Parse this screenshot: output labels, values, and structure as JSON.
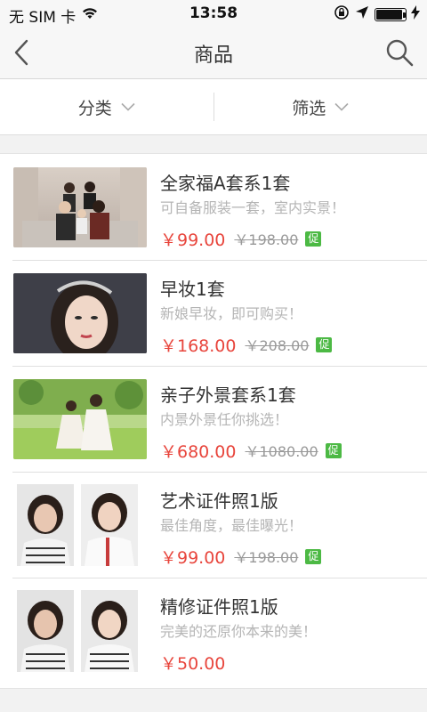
{
  "status_bar": {
    "carrier": "无 SIM 卡",
    "time": "13:58",
    "battery_level": 0.9
  },
  "nav": {
    "title": "商品",
    "back_icon": "chevron-left-icon",
    "search_icon": "search-icon"
  },
  "filters": [
    {
      "label": "分类",
      "icon": "chevron-down-icon"
    },
    {
      "label": "筛选",
      "icon": "chevron-down-icon"
    }
  ],
  "colors": {
    "price": "#e8453c",
    "promo_badge": "#4cb944"
  },
  "products": [
    {
      "title": "全家福A套系1套",
      "desc": "可自备服装一套，室内实景！",
      "price": "￥99.00",
      "old_price": "￥198.00",
      "badge": "促"
    },
    {
      "title": "早妆1套",
      "desc": "新娘早妆，即可购买！",
      "price": "￥168.00",
      "old_price": "￥208.00",
      "badge": "促"
    },
    {
      "title": "亲子外景套系1套",
      "desc": "内景外景任你挑选！",
      "price": "￥680.00",
      "old_price": "￥1080.00",
      "badge": "促"
    },
    {
      "title": "艺术证件照1版",
      "desc": "最佳角度，最佳曝光！",
      "price": "￥99.00",
      "old_price": "￥198.00",
      "badge": "促"
    },
    {
      "title": "精修证件照1版",
      "desc": "完美的还原你本来的美！",
      "price": "￥50.00"
    }
  ]
}
